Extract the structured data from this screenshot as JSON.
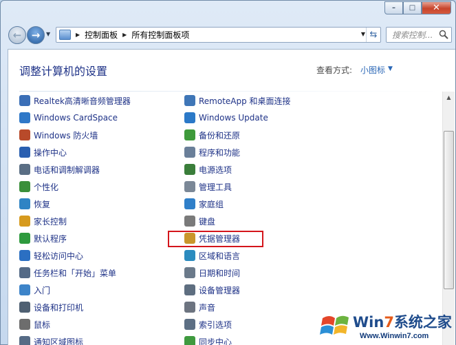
{
  "window": {
    "minimize_glyph": "–",
    "maximize_glyph": "□",
    "close_glyph": "✕"
  },
  "nav": {
    "back_glyph": "←",
    "forward_glyph": "→",
    "breadcrumbs": [
      "控制面板",
      "所有控制面板项"
    ],
    "search_placeholder": "搜索控制..."
  },
  "header": {
    "title": "调整计算机的设置",
    "view_label": "查看方式:",
    "view_value": "小图标"
  },
  "items": [
    {
      "label": "Realtek高清晰音频管理器",
      "icon": "realtek-audio-icon",
      "color": "#3b6fb7"
    },
    {
      "label": "Windows CardSpace",
      "icon": "cardspace-icon",
      "color": "#2f78c8"
    },
    {
      "label": "Windows 防火墙",
      "icon": "firewall-icon",
      "color": "#b84a2a"
    },
    {
      "label": "操作中心",
      "icon": "action-center-flag-icon",
      "color": "#2a5fb0"
    },
    {
      "label": "电话和调制解调器",
      "icon": "phone-modem-icon",
      "color": "#5a6e84"
    },
    {
      "label": "个性化",
      "icon": "personalization-icon",
      "color": "#3a8f3a"
    },
    {
      "label": "恢复",
      "icon": "recovery-icon",
      "color": "#2f84c4"
    },
    {
      "label": "家长控制",
      "icon": "parental-controls-icon",
      "color": "#d69a1e"
    },
    {
      "label": "默认程序",
      "icon": "default-programs-icon",
      "color": "#2e9a3e"
    },
    {
      "label": "轻松访问中心",
      "icon": "ease-of-access-icon",
      "color": "#2b6fc2"
    },
    {
      "label": "任务栏和「开始」菜单",
      "icon": "taskbar-icon",
      "color": "#546a86"
    },
    {
      "label": "入门",
      "icon": "getting-started-icon",
      "color": "#3d84c9"
    },
    {
      "label": "设备和打印机",
      "icon": "devices-printers-icon",
      "color": "#4f6072"
    },
    {
      "label": "鼠标",
      "icon": "mouse-icon",
      "color": "#6d6d6d"
    },
    {
      "label": "通知区域图标",
      "icon": "notification-area-icon",
      "color": "#566b85"
    },
    {
      "label": "RemoteApp 和桌面连接",
      "icon": "remoteapp-icon",
      "color": "#3f76b7"
    },
    {
      "label": "Windows Update",
      "icon": "windows-update-icon",
      "color": "#2b79c8"
    },
    {
      "label": "备份和还原",
      "icon": "backup-restore-icon",
      "color": "#3e9a3b"
    },
    {
      "label": "程序和功能",
      "icon": "programs-features-icon",
      "color": "#6a7f99"
    },
    {
      "label": "电源选项",
      "icon": "power-options-icon",
      "color": "#3a7e3a"
    },
    {
      "label": "管理工具",
      "icon": "admin-tools-icon",
      "color": "#7b8897"
    },
    {
      "label": "家庭组",
      "icon": "homegroup-icon",
      "color": "#2f7fc9"
    },
    {
      "label": "键盘",
      "icon": "keyboard-icon",
      "color": "#7a7a7a"
    },
    {
      "label": "凭据管理器",
      "icon": "credential-manager-icon",
      "color": "#c9962b"
    },
    {
      "label": "区域和语言",
      "icon": "region-language-icon",
      "color": "#2b8bbf"
    },
    {
      "label": "日期和时间",
      "icon": "date-time-icon",
      "color": "#6b7a8a"
    },
    {
      "label": "设备管理器",
      "icon": "device-manager-icon",
      "color": "#5e6e80"
    },
    {
      "label": "声音",
      "icon": "sound-icon",
      "color": "#6d7480"
    },
    {
      "label": "索引选项",
      "icon": "indexing-options-icon",
      "color": "#5d6f84"
    },
    {
      "label": "同步中心",
      "icon": "sync-center-icon",
      "color": "#3f9a3f"
    }
  ],
  "highlight": {
    "target": "凭据管理器",
    "color": "#d4151b"
  },
  "watermark": {
    "brand_part1": "Win",
    "brand_seven": "7",
    "brand_part2": "系统之家",
    "url": "Www.Winwin7.com"
  }
}
